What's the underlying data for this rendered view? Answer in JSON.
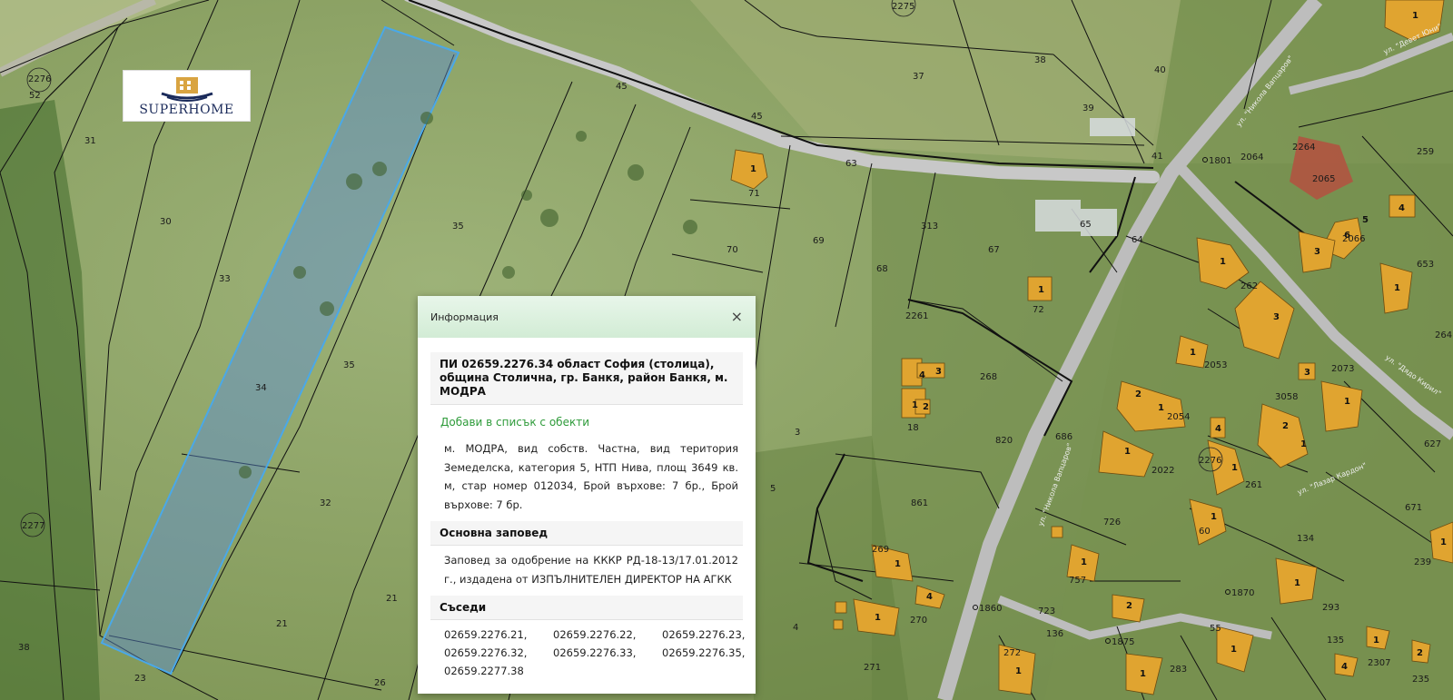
{
  "logo": {
    "text": "SUPERHOME"
  },
  "map": {
    "parcel_labels": [
      {
        "id": "52"
      },
      {
        "id": "31"
      },
      {
        "id": "30"
      },
      {
        "id": "33"
      },
      {
        "id": "34"
      },
      {
        "id": "35"
      },
      {
        "id": "35b",
        "text": "35"
      },
      {
        "id": "32"
      },
      {
        "id": "21"
      },
      {
        "id": "21b",
        "text": "21"
      },
      {
        "id": "23"
      },
      {
        "id": "26"
      },
      {
        "id": "38a",
        "text": "38"
      },
      {
        "id": "45"
      },
      {
        "id": "45b",
        "text": "45"
      },
      {
        "id": "37"
      },
      {
        "id": "38"
      },
      {
        "id": "40"
      },
      {
        "id": "39"
      },
      {
        "id": "41"
      },
      {
        "id": "71"
      },
      {
        "id": "63"
      },
      {
        "id": "70"
      },
      {
        "id": "69"
      },
      {
        "id": "68"
      },
      {
        "id": "67"
      },
      {
        "id": "65"
      },
      {
        "id": "64"
      },
      {
        "id": "72"
      },
      {
        "id": "2261"
      },
      {
        "id": "268"
      },
      {
        "id": "3"
      },
      {
        "id": "5"
      },
      {
        "id": "18"
      },
      {
        "id": "820"
      },
      {
        "id": "861"
      },
      {
        "id": "4"
      },
      {
        "id": "271"
      },
      {
        "id": "270"
      },
      {
        "id": "269"
      },
      {
        "id": "686"
      },
      {
        "id": "726"
      },
      {
        "id": "757"
      },
      {
        "id": "723"
      },
      {
        "id": "136"
      },
      {
        "id": "272"
      },
      {
        "id": "283"
      },
      {
        "id": "262"
      },
      {
        "id": "2053"
      },
      {
        "id": "2054"
      },
      {
        "id": "2022"
      },
      {
        "id": "261"
      },
      {
        "id": "60"
      },
      {
        "id": "134"
      },
      {
        "id": "3058"
      },
      {
        "id": "2073"
      },
      {
        "id": "293"
      },
      {
        "id": "671"
      },
      {
        "id": "239"
      },
      {
        "id": "135"
      },
      {
        "id": "2307"
      },
      {
        "id": "235"
      },
      {
        "id": "259"
      },
      {
        "id": "2065"
      },
      {
        "id": "2066"
      },
      {
        "id": "653"
      },
      {
        "id": "264"
      },
      {
        "id": "2064"
      },
      {
        "id": "313"
      },
      {
        "id": "627"
      },
      {
        "id": "55"
      },
      {
        "id": "2276"
      },
      {
        "id": "2277"
      },
      {
        "id": "2276b",
        "text": "2276"
      },
      {
        "id": "2275"
      },
      {
        "id": "2264"
      }
    ],
    "markers": [
      "1801",
      "1860",
      "1870",
      "1875"
    ],
    "streets": [
      "ул. \"Никола Вапцаров\"",
      "ул. \"Никола Вапцаров\"",
      "ул. \"Девет Юни\"",
      "ул. \"Дядо Кирил\"",
      "ул. \"Лазар Кардон\""
    ]
  },
  "info": {
    "title": "Информация",
    "close": "×",
    "parcel_heading": "ПИ 02659.2276.34 област София (столица), община Столична, гр. Банкя, район Банкя, м. МОДРА",
    "add_link": "Добави в списък с обекти",
    "description": "м. МОДРА, вид собств. Частна, вид територия Земеделска, категория 5, НТП Нива, площ 3649 кв. м, стар номер 012034, Брой върхове: 7 бр., Брой върхове: 7 бр.",
    "order_heading": "Основна заповед",
    "order_text": "Заповед за одобрение на КККР РД-18-13/17.01.2012 г., издадена от ИЗПЪЛНИТЕЛЕН ДИРЕКТОР НА АГКК",
    "neighbors_heading": "Съседи",
    "neighbors": [
      "02659.2276.21,",
      "02659.2276.22,",
      "02659.2276.23,",
      "02659.2276.32,",
      "02659.2276.33,",
      "02659.2276.35,",
      "02659.2277.38"
    ]
  },
  "colors": {
    "building": "#e0a430",
    "parcel_highlight": "#4aa8e8",
    "road": "#c6c6c6",
    "header_green": "#d8efda",
    "link_green": "#2e9b3a"
  }
}
